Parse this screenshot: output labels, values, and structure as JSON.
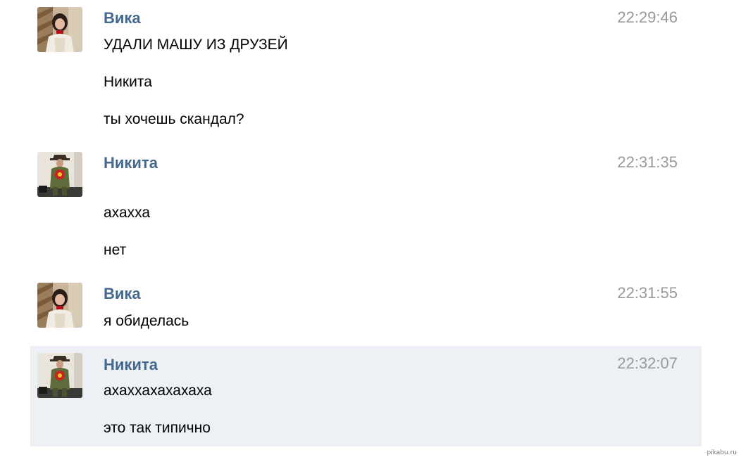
{
  "messages": [
    {
      "author": "Вика",
      "time": "22:29:46",
      "avatar": "avatar-vika",
      "lines": [
        "УДАЛИ МАШУ ИЗ ДРУЗЕЙ",
        "Никита",
        "ты хочешь скандал?"
      ]
    },
    {
      "author": "Никита",
      "time": "22:31:35",
      "avatar": "avatar-nikita",
      "lines": [
        "ахахха",
        "нет"
      ]
    },
    {
      "author": "Вика",
      "time": "22:31:55",
      "avatar": "avatar-vika",
      "lines": [
        "я обиделась"
      ]
    },
    {
      "author": "Никита",
      "time": "22:32:07",
      "avatar": "avatar-nikita",
      "highlighted": true,
      "lines": [
        "ахаххахахахаха",
        "это так типично"
      ]
    }
  ],
  "watermark": "pikabu.ru",
  "colors": {
    "author": "#45688e",
    "time": "#999999",
    "highlight_bg": "#edf1f5"
  }
}
